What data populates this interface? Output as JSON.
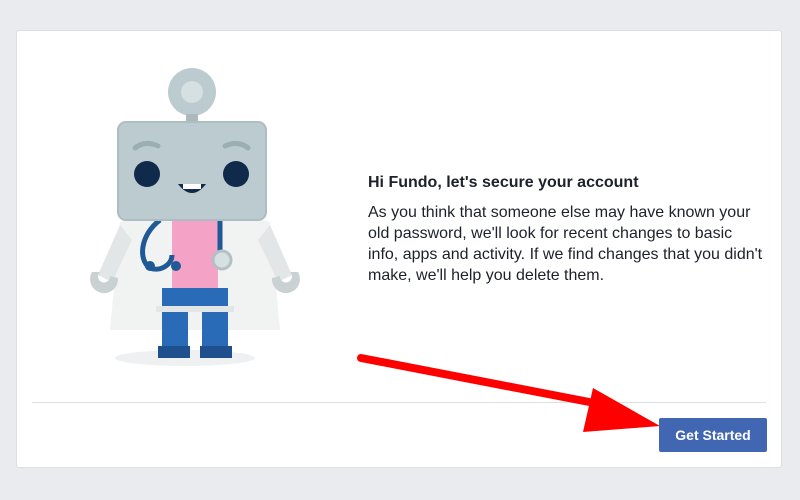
{
  "dialog": {
    "heading": "Hi Fundo, let's secure your account",
    "body": "As you think that someone else may have known your old password, we'll look for recent changes to basic info, apps and activity. If we find changes that you didn't make, we'll help you delete them.",
    "get_started_label": "Get Started"
  },
  "colors": {
    "button": "#4267b2",
    "arrow": "#ff0000",
    "page_background": "#e9ebee"
  },
  "illustration": {
    "icon": "doctor-robot-illustration"
  }
}
